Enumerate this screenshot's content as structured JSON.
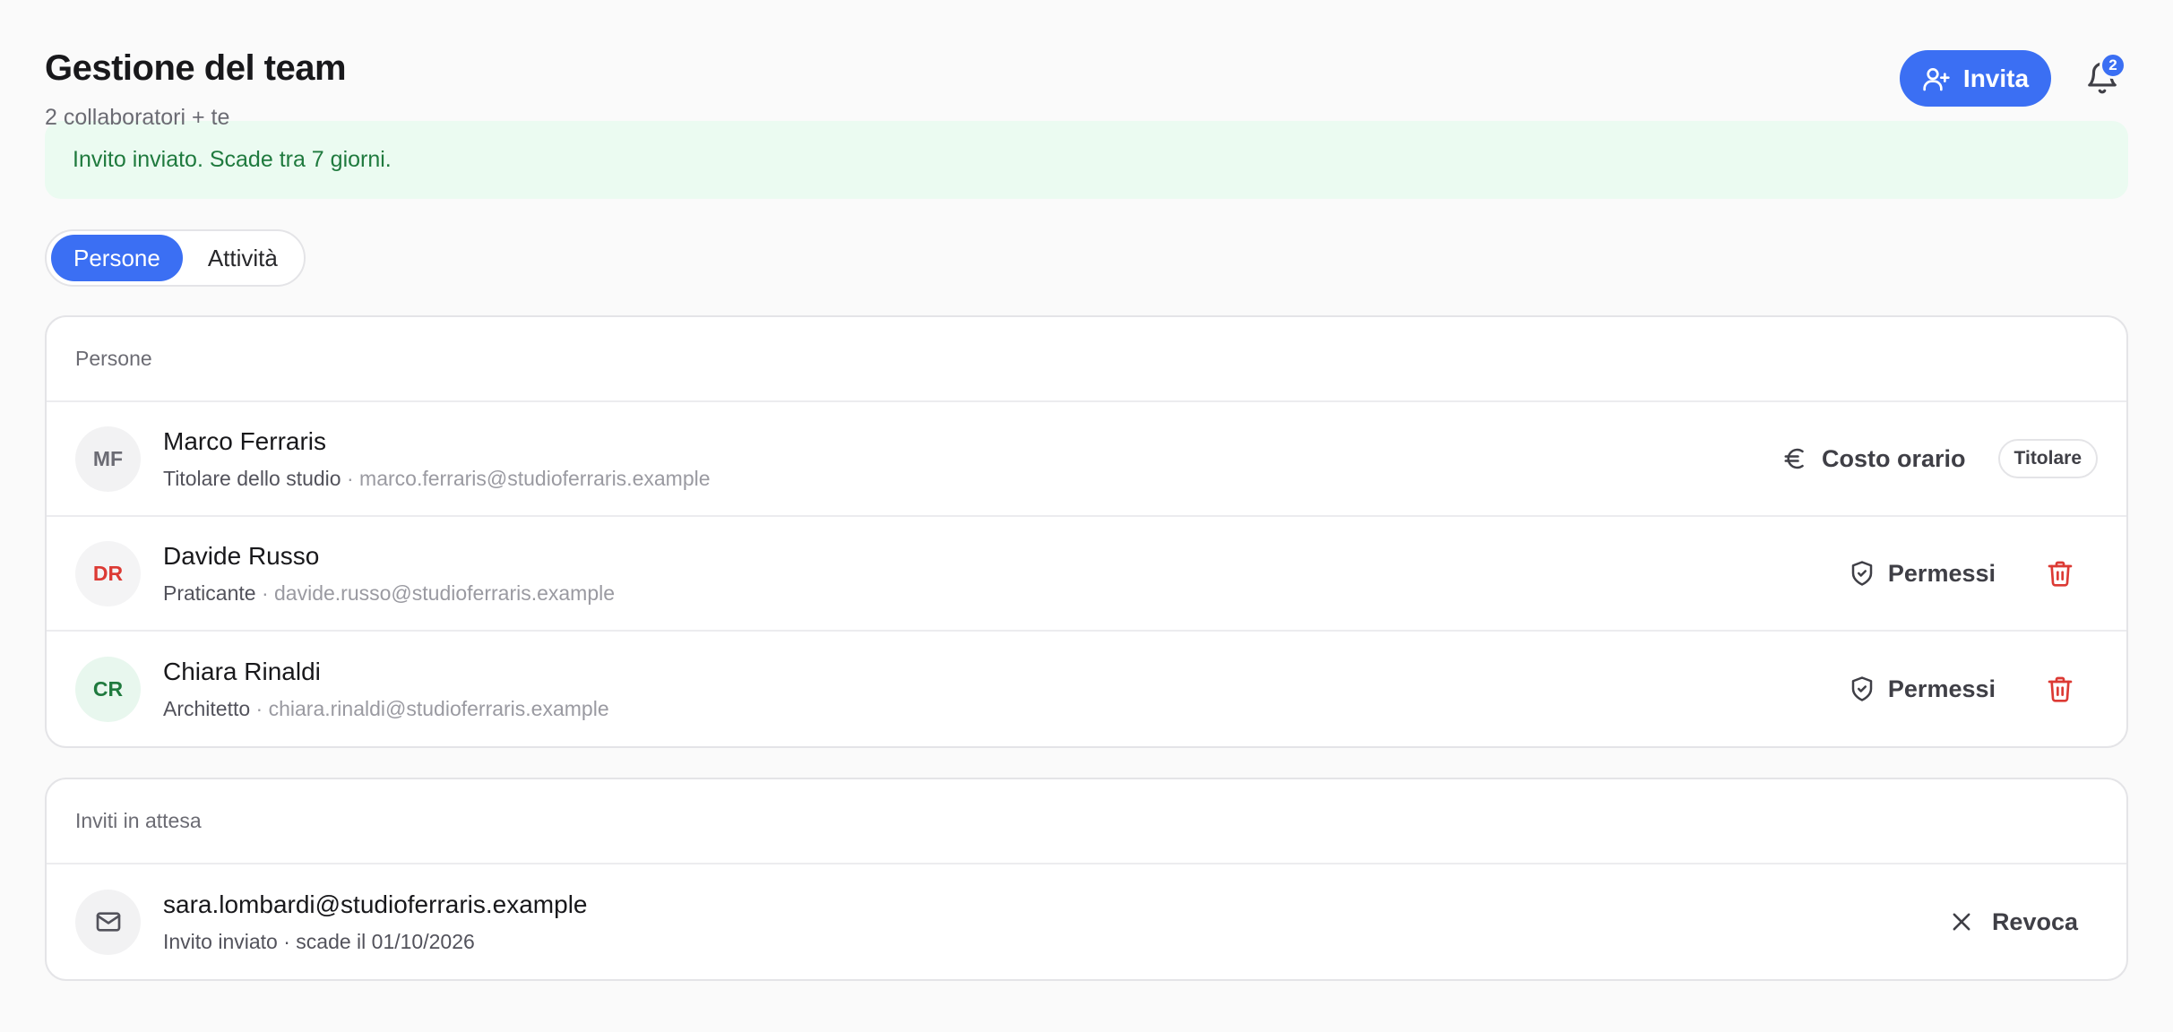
{
  "header": {
    "title": "Gestione del team",
    "subtitle": "2 collaboratori + te",
    "invite_label": "Invita",
    "notification_count": "2"
  },
  "banner": {
    "text": "Invito inviato. Scade tra 7 giorni."
  },
  "tabs": [
    {
      "label": "Persone",
      "active": true
    },
    {
      "label": "Attività",
      "active": false
    }
  ],
  "people": {
    "heading": "Persone",
    "rows": [
      {
        "initials": "MF",
        "name": "Marco Ferraris",
        "role": "Titolare dello studio",
        "separator": " · ",
        "email": "marco.ferraris@studioferraris.example",
        "action_label": "Costo orario",
        "action_icon": "euro-icon",
        "badge": "Titolare"
      },
      {
        "initials": "DR",
        "name": "Davide Russo",
        "role": "Praticante",
        "separator": " · ",
        "email": "davide.russo@studioferraris.example",
        "action_label": "Permessi",
        "action_icon": "shield-check-icon"
      },
      {
        "initials": "CR",
        "name": "Chiara Rinaldi",
        "role": "Architetto",
        "separator": " · ",
        "email": "chiara.rinaldi@studioferraris.example",
        "action_label": "Permessi",
        "action_icon": "shield-check-icon"
      }
    ]
  },
  "invites": {
    "heading": "Inviti in attesa",
    "rows": [
      {
        "email": "sara.lombardi@studioferraris.example",
        "status": "Invito inviato · scade il 01/10/2026",
        "action_label": "Revoca"
      }
    ]
  },
  "colors": {
    "accent": "#3b6ff3",
    "success_bg": "#ebfbf1",
    "success_text": "#1f7a3e",
    "danger": "#dc3a34"
  }
}
